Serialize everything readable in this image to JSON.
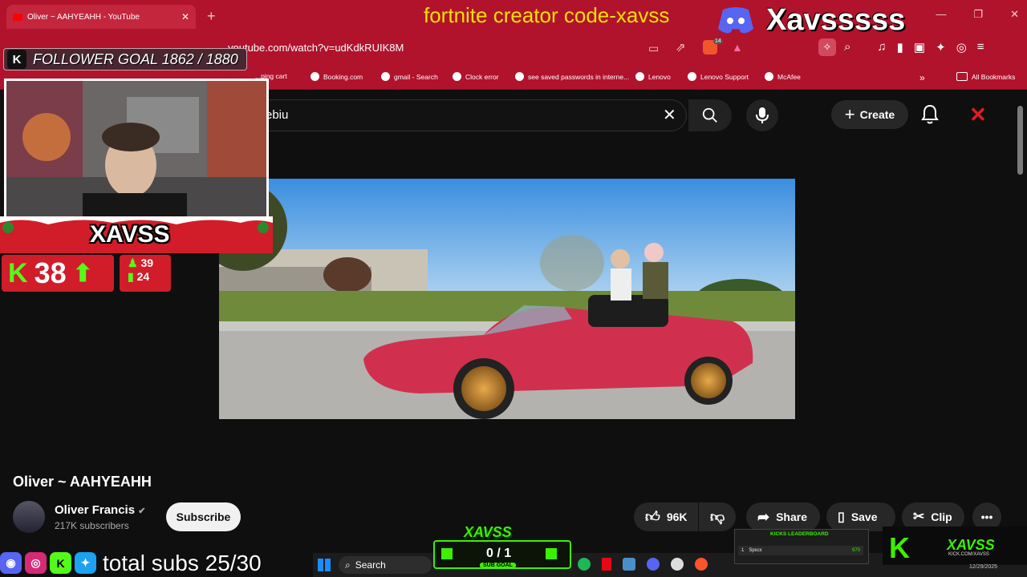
{
  "browser": {
    "tab_title": "Oliver ~ AAHYEAHH - YouTube",
    "url": "youtube.com/watch?v=udKdkRUIK8M",
    "bookmarks": [
      "...ping cart",
      "Booking.com",
      "gmail - Search",
      "Clock error",
      "see saved passwords in interne...",
      "Lenovo",
      "Lenovo Support",
      "McAfee"
    ],
    "all_bookmarks": "All Bookmarks",
    "extension_count": "14",
    "accent": "#b1132c"
  },
  "youtube": {
    "search_value": "ebiu",
    "create_label": "Create",
    "video_title": "Oliver ~ AAHYEAHH",
    "channel_name": "Oliver Francis",
    "subscribers": "217K subscribers",
    "subscribe_label": "Subscribe",
    "likes": "96K",
    "share_label": "Share",
    "save_label": "Save",
    "clip_label": "Clip"
  },
  "overlay": {
    "sponsor_text": "fortnite creator code-xavss",
    "streamer_name": "Xavsssss",
    "follower_goal": "FOLLOWER GOAL 1862 / 1880",
    "follower_goal_fraction": 0.99,
    "cam_name": "XAVSS",
    "kick_viewers": "38",
    "stat_followers": "39",
    "stat_viewers": "24",
    "social_text": "total subs 25/30",
    "sub_goal_title": "XAVSS",
    "sub_goal_value": "0 / 1",
    "sub_goal_label": "SUB GOAL",
    "leaderboard_title": "KICKS LEADERBOARD",
    "leaderboard_rank": "1",
    "leaderboard_user": "Spxcx",
    "leaderboard_score": "970",
    "kick_name": "XAVSS",
    "kick_url": "KICK.COM/XAVSS",
    "kick_color": "#3cf000"
  },
  "taskbar": {
    "search_label": "Search",
    "date": "12/29/2025"
  }
}
